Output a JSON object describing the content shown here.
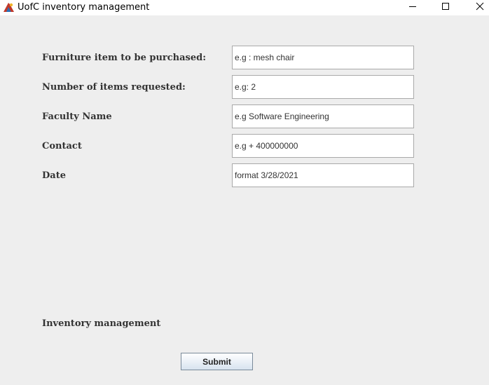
{
  "window": {
    "title": "UofC inventory management",
    "icon": "java-app-icon",
    "controls": {
      "minimize_icon": "minimize-icon",
      "maximize_icon": "maximize-icon",
      "close_icon": "close-icon"
    }
  },
  "form": {
    "fields": [
      {
        "label": "Furniture item to be purchased:",
        "value": "e.g : mesh chair"
      },
      {
        "label": "Number of items requested:",
        "value": "e.g: 2"
      },
      {
        "label": "Faculty Name",
        "value": "e.g Software Engineering"
      },
      {
        "label": "Contact",
        "value": "e.g + 400000000"
      },
      {
        "label": "Date",
        "value": "format 3/28/2021"
      }
    ]
  },
  "footer": {
    "label": "Inventory management",
    "submit_label": "Submit"
  },
  "colors": {
    "content_background": "#eeeeee",
    "label_text": "#333333",
    "input_border": "#a9a9a9"
  }
}
